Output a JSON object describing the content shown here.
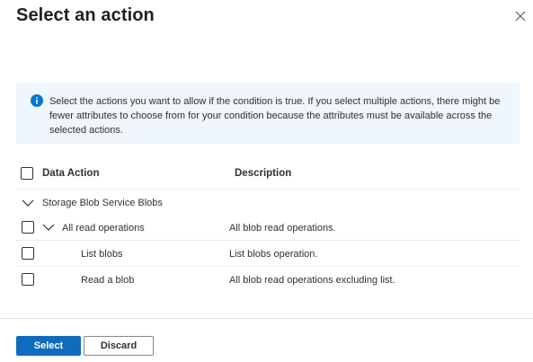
{
  "dialog": {
    "title": "Select an action"
  },
  "info": {
    "message": "Select the actions you want to allow if the condition is true. If you select multiple actions, there might be fewer attributes to choose from for your condition because the attributes must be available across the selected actions."
  },
  "table": {
    "headers": {
      "action": "Data Action",
      "description": "Description"
    },
    "group": {
      "label": "Storage Blob Service Blobs",
      "expanded": true
    },
    "rows": [
      {
        "action": "All read operations",
        "description": "All blob read operations.",
        "expanded": true
      },
      {
        "action": "List blobs",
        "description": "List blobs operation."
      },
      {
        "action": "Read a blob",
        "description": "All blob read operations excluding list."
      }
    ]
  },
  "footer": {
    "select_label": "Select",
    "discard_label": "Discard"
  },
  "colors": {
    "accent": "#0f6cbd",
    "info_bg": "#eff6fc",
    "info_icon": "#0078d4"
  },
  "icons": [
    "close-icon",
    "info-icon",
    "chevron-down-icon"
  ]
}
